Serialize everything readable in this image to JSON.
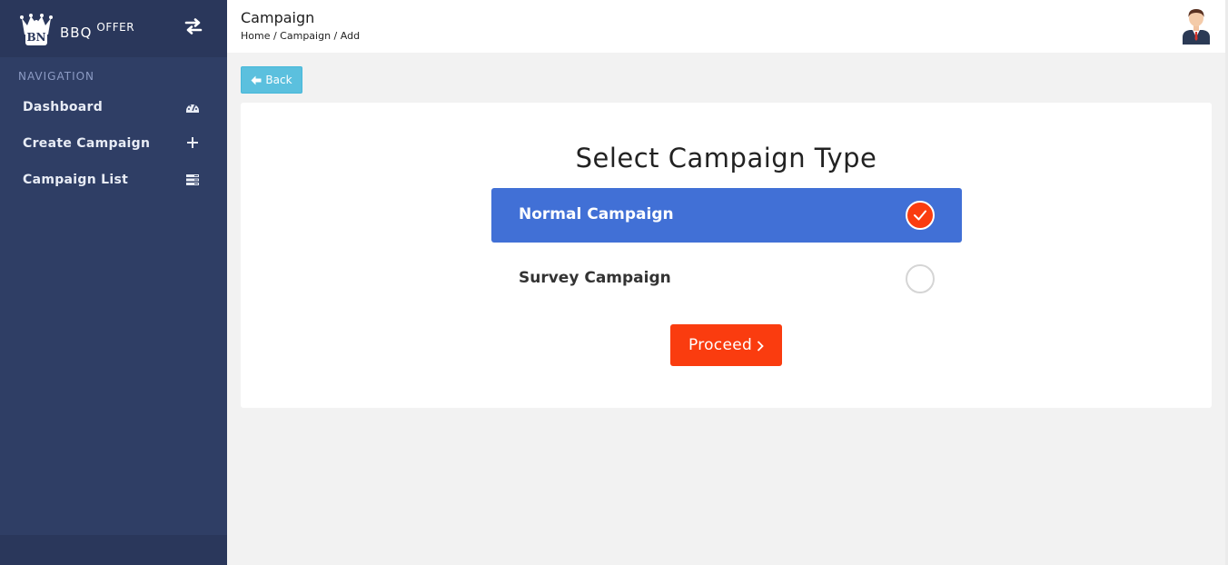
{
  "brand": {
    "name": "BBQ",
    "suffix": "OFFER",
    "logo_initials": "BN"
  },
  "sidebar": {
    "heading": "NAVIGATION",
    "items": [
      {
        "label": "Dashboard",
        "icon": "dashboard-icon"
      },
      {
        "label": "Create Campaign",
        "icon": "plus-icon"
      },
      {
        "label": "Campaign List",
        "icon": "list-icon"
      }
    ]
  },
  "header": {
    "title": "Campaign",
    "breadcrumb": "Home / Campaign / Add"
  },
  "back_button": {
    "label": "Back"
  },
  "card": {
    "title": "Select Campaign Type",
    "options": [
      {
        "label": "Normal Campaign",
        "selected": true
      },
      {
        "label": "Survey Campaign",
        "selected": false
      }
    ],
    "proceed_label": "Proceed"
  },
  "colors": {
    "sidebar": "#2f3e65",
    "accent_blue": "#4170d6",
    "accent_orange": "#fa3c0f",
    "back_button": "#5bc0de"
  }
}
